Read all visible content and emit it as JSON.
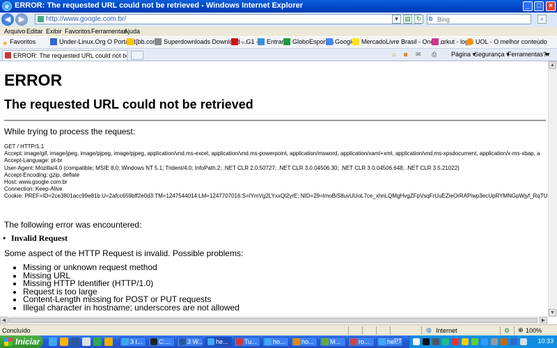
{
  "window": {
    "title": "ERROR: The requested URL could not be retrieved - Windows Internet Explorer",
    "minimize": "_",
    "maximize": "□",
    "close": "×"
  },
  "nav": {
    "back": "◀",
    "forward": "▶",
    "address": "http://www.google.com.br/",
    "search_placeholder": "Bing",
    "search_brand": "b"
  },
  "menu": [
    "Arquivo",
    "Editar",
    "Exibir",
    "Favoritos",
    "Ferramentas",
    "Ajuda"
  ],
  "favorites": {
    "label": "Favoritos",
    "items": [
      "Under-Linux.Org O Portal d...",
      "[bb.com",
      "Superdownloads Download ...",
      "-- G1 --",
      "Entrar",
      "GloboEsportes",
      "Google",
      "MercadoLivre Brasil - Onde ...",
      "orkut - login",
      "UOL - O melhor conteúdo"
    ]
  },
  "tab": {
    "title": "ERROR: The requested URL could not be retrieved",
    "commands": [
      "Página ▾",
      "Segurança ▾",
      "Ferramentas ▾",
      "?▾"
    ]
  },
  "page": {
    "h1": "ERROR",
    "h2": "The requested URL could not be retrieved",
    "intro": "While trying to process the request:",
    "request": [
      "GET / HTTP/1.1",
      "Accept: image/gif, image/jpeg, image/pjpeg, image/pjpeg, application/vnd.ms-excel, application/vnd.ms-powerpoint, application/msword, application/xaml+xml, application/vnd.ms-xpsdocument, application/x-ms-xbap, a",
      "Accept-Language: pt-br",
      "User-Agent: Mozilla/4.0 (compatible; MSIE 8.0; Windows NT 5.1; Trident/4.0; InfoPath.2; .NET CLR 2.0.50727; .NET CLR 3.0.04506.30; .NET CLR 3.0.04506.648; .NET CLR 3.5.21022)",
      "Accept-Encoding: gzip, deflate",
      "Host: www.google.com.br",
      "Connection: Keep-Alive",
      "Cookie: PREF=ID=2ce3801acc99e81b:U=2afcc659bff2e0d3:TM=1247544014:LM=1247707016:S=lYmVg2LYxxQl2yrE; NID=29=lmoBiS8uvUUoL7ce_xhnLQMgHvgZFpVsqFrUuEZieOrRAPiwp3ecUpRYMNGpWjyf_RqTU"
    ],
    "error_intro": "The following error was encountered:",
    "error_name": "Invalid Request",
    "problems_intro": "Some aspect of the HTTP Request is invalid. Possible problems:",
    "problems": [
      "Missing or unknown request method",
      "Missing URL",
      "Missing HTTP Identifier (HTTP/1.0)",
      "Request is too large",
      "Content-Length missing for POST or PUT requests",
      "Illegal character in hostname; underscores are not allowed"
    ]
  },
  "status": {
    "left": "Concluído",
    "zone": "Internet",
    "zoom": "100%"
  },
  "taskbar": {
    "start": "Iniciar",
    "tasks": [
      "3 I...",
      "C:...",
      "3 W...",
      "he...",
      "Tu...",
      "ho...",
      "ho...",
      "M...",
      "ro...",
      "he..."
    ],
    "language": "PT",
    "time": "10:33"
  },
  "colors": {
    "titlebar": "#0046c7",
    "taskbar": "#225ddb",
    "start": "#3a9a33",
    "chrome": "#ece9d8"
  }
}
